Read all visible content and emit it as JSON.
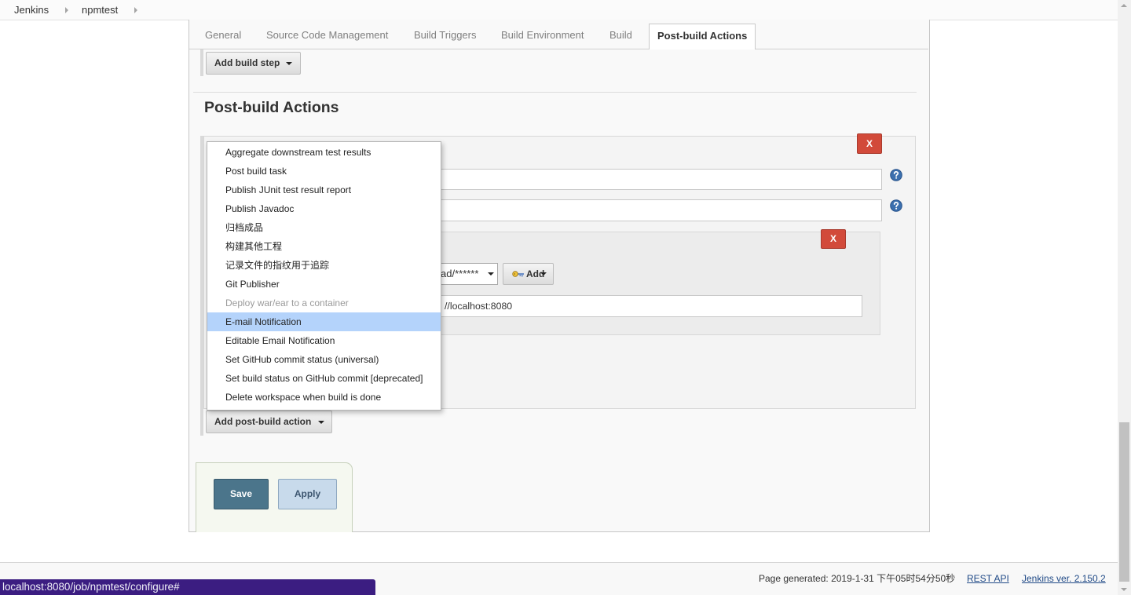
{
  "breadcrumb": {
    "items": [
      {
        "label": "Jenkins"
      },
      {
        "label": "npmtest"
      }
    ]
  },
  "tabs": [
    {
      "label": "General"
    },
    {
      "label": "Source Code Management"
    },
    {
      "label": "Build Triggers"
    },
    {
      "label": "Build Environment"
    },
    {
      "label": "Build"
    },
    {
      "label": "Post-build Actions",
      "selected": true
    }
  ],
  "build_section": {
    "add_build_step_label": "Add build step"
  },
  "post_build_section": {
    "heading": "Post-build Actions",
    "action": {
      "remove_label": "X",
      "publisher": {
        "remove_label": "X",
        "credentials_value": "ad/******",
        "credentials_add_label": "Add",
        "url_value": "//localhost:8080"
      }
    },
    "add_action_label": "Add post-build action"
  },
  "add_action_menu": {
    "items": [
      {
        "label": "Aggregate downstream test results"
      },
      {
        "label": "Post build task"
      },
      {
        "label": "Publish JUnit test result report"
      },
      {
        "label": "Publish Javadoc"
      },
      {
        "label": "归档成品"
      },
      {
        "label": "构建其他工程"
      },
      {
        "label": "记录文件的指纹用于追踪"
      },
      {
        "label": "Git Publisher"
      },
      {
        "label": "Deploy war/ear to a container",
        "disabled": true
      },
      {
        "label": "E-mail Notification",
        "highlighted": true
      },
      {
        "label": "Editable Email Notification"
      },
      {
        "label": "Set GitHub commit status (universal)"
      },
      {
        "label": "Set build status on GitHub commit [deprecated]"
      },
      {
        "label": "Delete workspace when build is done"
      }
    ]
  },
  "form_actions": {
    "save_label": "Save",
    "apply_label": "Apply"
  },
  "footer": {
    "page_generated": "Page generated: 2019-1-31 下午05时54分50秒",
    "rest_api": "REST API",
    "version": "Jenkins ver. 2.150.2"
  },
  "status_bar": {
    "url": "localhost:8080/job/npmtest/configure#"
  },
  "colors": {
    "save_button": "#4b758b",
    "apply_button": "#c8daeb",
    "remove_button": "#d24a3a",
    "menu_highlight": "#b4d3fb",
    "link": "#204a87",
    "status_bar": "#3b1d81",
    "help_icon": "#3b6fae"
  },
  "icons": {
    "breadcrumb_separator": "breadcrumb-arrow-icon",
    "dropdown": "caret-down-icon",
    "help": "help-icon",
    "credentials": "key-icon",
    "scroll_up": "scroll-up-arrow-icon",
    "scroll_down": "scroll-down-arrow-icon"
  }
}
